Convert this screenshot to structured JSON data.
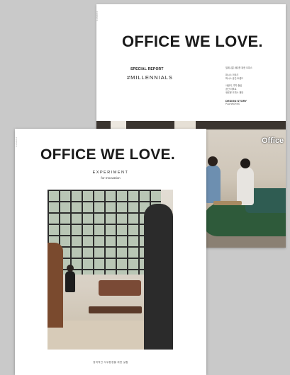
{
  "back_cover": {
    "title": "OFFICE WE LOVE.",
    "special_report": "SPECIAL REPORT",
    "hashtag": "#MILLENNIALS",
    "sign_text": "Office",
    "toc": [
      "밀레니얼 세대를 위한 오피스",
      "퍼시스 이야기",
      "퍼시스 공간 트렌드",
      "사람이, 가치 중심",
      "공간 리포트",
      "새로운 오피스 제안"
    ],
    "design_story": "DESIGN STORY",
    "design_story_sub": "PLAYWORKS"
  },
  "front_cover": {
    "title": "OFFICE WE LOVE.",
    "experiment": "EXPERIMENT",
    "subtitle": "for Innovation",
    "caption": "창의적인 사무환경을 위한 실험"
  }
}
